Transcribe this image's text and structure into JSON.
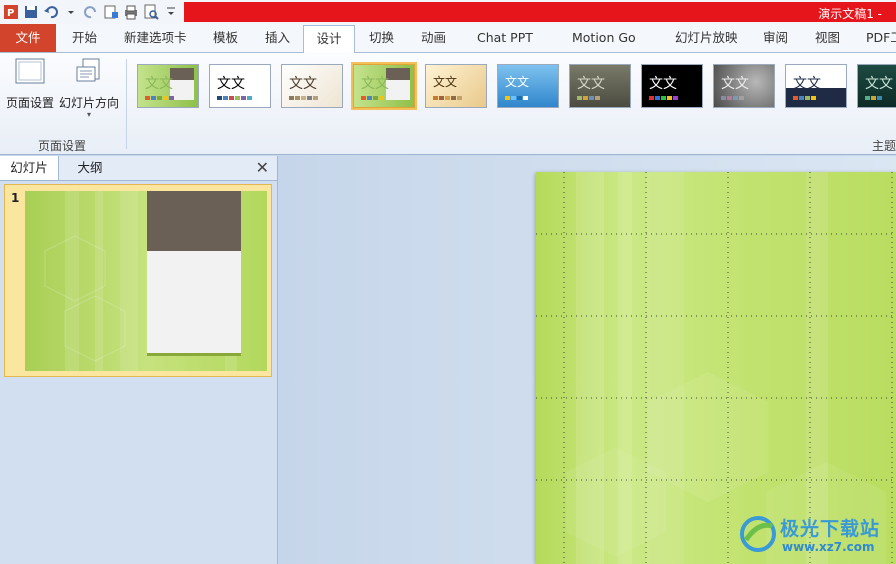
{
  "title_bar": {
    "document_title": "演示文稿1 -"
  },
  "tabs": [
    {
      "label": "文件"
    },
    {
      "label": "开始"
    },
    {
      "label": "新建选项卡"
    },
    {
      "label": "模板"
    },
    {
      "label": "插入"
    },
    {
      "label": "设计"
    },
    {
      "label": "切换"
    },
    {
      "label": "动画"
    },
    {
      "label": "Chat PPT"
    },
    {
      "label": "Motion Go"
    },
    {
      "label": "幻灯片放映"
    },
    {
      "label": "审阅"
    },
    {
      "label": "视图"
    },
    {
      "label": "PDF工"
    }
  ],
  "active_tab": "设计",
  "ribbon": {
    "page_setup_label": "页面设置",
    "orientation_label": "幻灯片方向",
    "group_label": "页面设置",
    "themes_group_label": "主题",
    "theme_sample_text": "文文"
  },
  "left_pane": {
    "tabs": [
      {
        "label": "幻灯片"
      },
      {
        "label": "大纲"
      }
    ],
    "close_glyph": "✕",
    "slide_number": "1"
  },
  "watermark": {
    "title": "极光下载站",
    "url": "www.xz7.com"
  },
  "colors": {
    "title_red": "#e6151b",
    "file_tab": "#d2452c",
    "slide_green": "#b9dc62"
  }
}
